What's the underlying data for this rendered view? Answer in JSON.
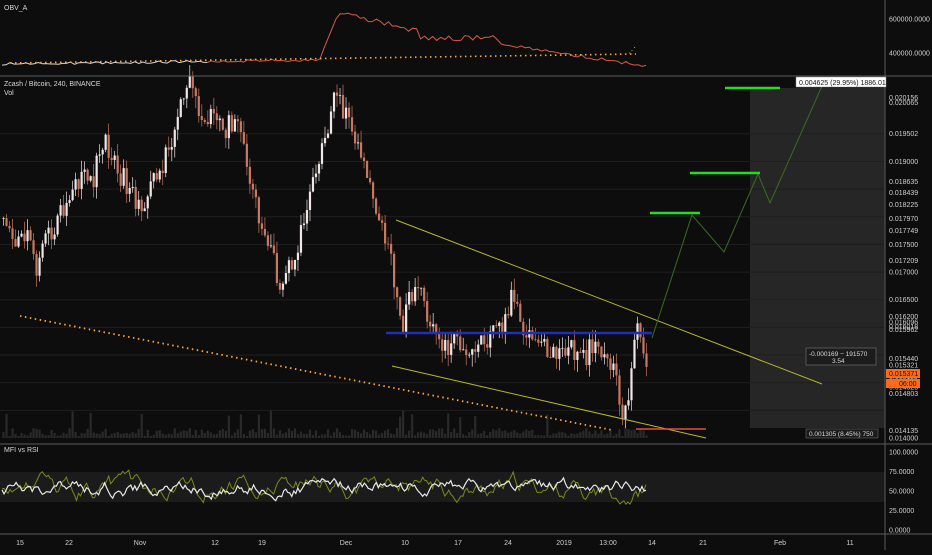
{
  "header": {
    "obv_label": "OBV_A",
    "main_title": "Zcash / Bitcoin, 240, BINANCE",
    "vol_label": "Vol",
    "rsi_label": "MFI vs RSI"
  },
  "colors": {
    "background": "#0d0d0d",
    "up_candle": "#f0e6e6",
    "down_candle": "#c87860",
    "obv_line": "#d8d8d8",
    "obv_red": "#d85a48",
    "dotted_orange": "#ffa640",
    "wedge": "#b8b830",
    "target_green": "#22dd22",
    "support_blue": "#1f2fb8",
    "stop_red": "#e05040",
    "projection": "#3c6a22",
    "rsi_line": "#e8e8e8",
    "mfi_line": "#7a8a20",
    "price_badge": "#ff6a1a"
  },
  "obv_axis": {
    "labels": [
      "600000.0000",
      "400000.0000"
    ]
  },
  "price_axis": {
    "labels": [
      "0.020156",
      "0.020065",
      "0.019502",
      "0.019000",
      "0.018635",
      "0.018439",
      "0.018225",
      "0.017970",
      "0.017749",
      "0.017500",
      "0.017209",
      "0.017000",
      "0.016500",
      "0.016200",
      "0.016096",
      "0.016018",
      "0.015962",
      "0.015440",
      "0.015321",
      "0.015115",
      "0.014923",
      "0.014803",
      "0.014135",
      "0.014000"
    ],
    "current_price": "0.015371",
    "current_countdown": "06:00"
  },
  "rsi_axis": {
    "labels": [
      "100.0000",
      "75.0000",
      "50.0000",
      "25.0000",
      "0.0000"
    ]
  },
  "time_axis": {
    "labels": [
      "15",
      "22",
      "Nov",
      "12",
      "19",
      "Dec",
      "10",
      "17",
      "24",
      "2019",
      "13:00",
      "14",
      "21",
      "Feb",
      "11"
    ]
  },
  "annotations": {
    "top_measure": "0.004625 (29.95%) 1886.01",
    "mid_measure_line1": "-0.000169 − 191570",
    "mid_measure_line2": "3.54",
    "bottom_measure": "0.001305 (8.45%) 750"
  },
  "chart_data": {
    "type": "candlestick",
    "title": "Zcash / Bitcoin, 240, BINANCE",
    "price_range": [
      0.014,
      0.0204
    ],
    "x_range": [
      "Oct 15 2018",
      "Feb 14 2019"
    ],
    "grid": true,
    "price_path": [
      [
        "Oct 15",
        0.0178
      ],
      [
        "Oct 16",
        0.0174
      ],
      [
        "Oct 17",
        0.0178
      ],
      [
        "Oct 18",
        0.017
      ],
      [
        "Oct 19",
        0.0176
      ],
      [
        "Oct 20",
        0.018
      ],
      [
        "Oct 21",
        0.0184
      ],
      [
        "Oct 22",
        0.0188
      ],
      [
        "Oct 24",
        0.0186
      ],
      [
        "Oct 26",
        0.0194
      ],
      [
        "Oct 28",
        0.019
      ],
      [
        "Oct 30",
        0.0186
      ],
      [
        "Nov 1",
        0.0182
      ],
      [
        "Nov 3",
        0.0184
      ],
      [
        "Nov 5",
        0.0188
      ],
      [
        "Nov 7",
        0.0192
      ],
      [
        "Nov 9",
        0.02
      ],
      [
        "Nov 11",
        0.0204
      ],
      [
        "Nov 13",
        0.0196
      ],
      [
        "Nov 15",
        0.0201
      ],
      [
        "Nov 17",
        0.0195
      ],
      [
        "Nov 19",
        0.0199
      ],
      [
        "Nov 21",
        0.019
      ],
      [
        "Nov 23",
        0.018
      ],
      [
        "Nov 25",
        0.0174
      ],
      [
        "Nov 26",
        0.0168
      ],
      [
        "Nov 27",
        0.0172
      ],
      [
        "Nov 28",
        0.0178
      ],
      [
        "Nov 29",
        0.0186
      ],
      [
        "Nov 30",
        0.0194
      ],
      [
        "Dec 1",
        0.0202
      ],
      [
        "Dec 2",
        0.0198
      ],
      [
        "Dec 3",
        0.0192
      ],
      [
        "Dec 4",
        0.0186
      ],
      [
        "Dec 5",
        0.018
      ],
      [
        "Dec 6",
        0.0172
      ],
      [
        "Dec 7",
        0.016
      ],
      [
        "Dec 8",
        0.0168
      ],
      [
        "Dec 9",
        0.0164
      ],
      [
        "Dec 10",
        0.0158
      ],
      [
        "Dec 12",
        0.0156
      ],
      [
        "Dec 14",
        0.0158
      ],
      [
        "Dec 16",
        0.0156
      ],
      [
        "Dec 18",
        0.0157
      ],
      [
        "Dec 20",
        0.0158
      ],
      [
        "Dec 22",
        0.016
      ],
      [
        "Dec 24",
        0.0166
      ],
      [
        "Dec 26",
        0.016
      ],
      [
        "Dec 28",
        0.0158
      ],
      [
        "Dec 30",
        0.0156
      ],
      [
        "Jan 1",
        0.0155
      ],
      [
        "Jan 3",
        0.0157
      ],
      [
        "Jan 5",
        0.0154
      ],
      [
        "Jan 7",
        0.0156
      ],
      [
        "Jan 9",
        0.0155
      ],
      [
        "Jan 11",
        0.0153
      ],
      [
        "Jan 12",
        0.0142
      ],
      [
        "Jan 12b",
        0.016
      ],
      [
        "Jan 13",
        0.0154
      ]
    ],
    "targets": [
      {
        "label": "target-1",
        "price": 0.017749
      },
      {
        "label": "target-2",
        "price": 0.018439
      },
      {
        "label": "target-3",
        "price": 0.020065
      }
    ],
    "support_level": 0.016018,
    "stop_level": 0.014135
  }
}
